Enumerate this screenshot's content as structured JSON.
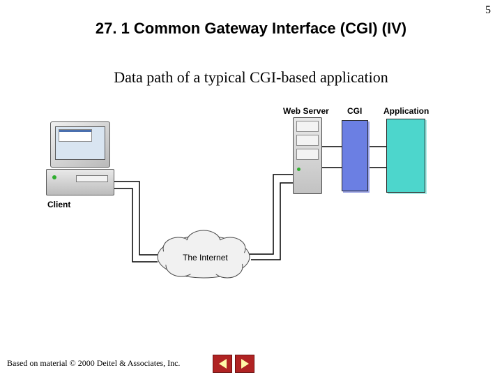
{
  "slide": {
    "number": "5",
    "title": "27. 1 Common Gateway Interface (CGI) (IV)",
    "subtitle": "Data path of a typical CGI-based application"
  },
  "labels": {
    "web_server": "Web Server",
    "cgi": "CGI",
    "application": "Application",
    "client": "Client",
    "internet": "The Internet"
  },
  "footer": "Based on material © 2000 Deitel & Associates, Inc.",
  "nav": {
    "prev": "previous-slide",
    "next": "next-slide"
  }
}
